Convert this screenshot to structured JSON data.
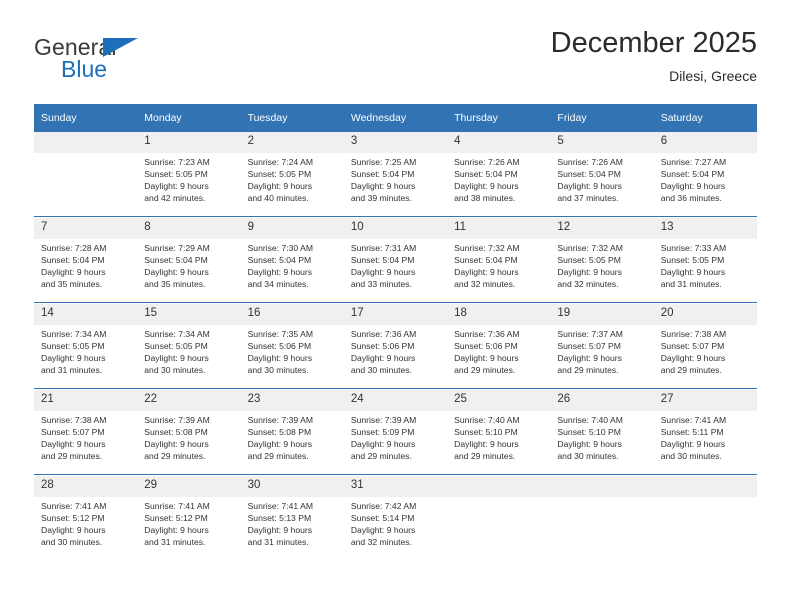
{
  "brand": {
    "name_part1": "General",
    "name_part2": "Blue",
    "triangle_color": "#1c6fba",
    "text_color": "#3a3a3a"
  },
  "header": {
    "title": "December 2025",
    "subtitle": "Dilesi, Greece"
  },
  "theme": {
    "header_blue": "#3273b4",
    "daynum_background": "#f0f0f0",
    "page_background": "#ffffff",
    "text_color": "#333333"
  },
  "calendar": {
    "weekday_headers": [
      "Sunday",
      "Monday",
      "Tuesday",
      "Wednesday",
      "Thursday",
      "Friday",
      "Saturday"
    ],
    "weeks": [
      {
        "days": [
          {
            "number": "",
            "lines": []
          },
          {
            "number": "1",
            "lines": [
              "Sunrise: 7:23 AM",
              "Sunset: 5:05 PM",
              "Daylight: 9 hours",
              "and 42 minutes."
            ]
          },
          {
            "number": "2",
            "lines": [
              "Sunrise: 7:24 AM",
              "Sunset: 5:05 PM",
              "Daylight: 9 hours",
              "and 40 minutes."
            ]
          },
          {
            "number": "3",
            "lines": [
              "Sunrise: 7:25 AM",
              "Sunset: 5:04 PM",
              "Daylight: 9 hours",
              "and 39 minutes."
            ]
          },
          {
            "number": "4",
            "lines": [
              "Sunrise: 7:26 AM",
              "Sunset: 5:04 PM",
              "Daylight: 9 hours",
              "and 38 minutes."
            ]
          },
          {
            "number": "5",
            "lines": [
              "Sunrise: 7:26 AM",
              "Sunset: 5:04 PM",
              "Daylight: 9 hours",
              "and 37 minutes."
            ]
          },
          {
            "number": "6",
            "lines": [
              "Sunrise: 7:27 AM",
              "Sunset: 5:04 PM",
              "Daylight: 9 hours",
              "and 36 minutes."
            ]
          }
        ]
      },
      {
        "days": [
          {
            "number": "7",
            "lines": [
              "Sunrise: 7:28 AM",
              "Sunset: 5:04 PM",
              "Daylight: 9 hours",
              "and 35 minutes."
            ]
          },
          {
            "number": "8",
            "lines": [
              "Sunrise: 7:29 AM",
              "Sunset: 5:04 PM",
              "Daylight: 9 hours",
              "and 35 minutes."
            ]
          },
          {
            "number": "9",
            "lines": [
              "Sunrise: 7:30 AM",
              "Sunset: 5:04 PM",
              "Daylight: 9 hours",
              "and 34 minutes."
            ]
          },
          {
            "number": "10",
            "lines": [
              "Sunrise: 7:31 AM",
              "Sunset: 5:04 PM",
              "Daylight: 9 hours",
              "and 33 minutes."
            ]
          },
          {
            "number": "11",
            "lines": [
              "Sunrise: 7:32 AM",
              "Sunset: 5:04 PM",
              "Daylight: 9 hours",
              "and 32 minutes."
            ]
          },
          {
            "number": "12",
            "lines": [
              "Sunrise: 7:32 AM",
              "Sunset: 5:05 PM",
              "Daylight: 9 hours",
              "and 32 minutes."
            ]
          },
          {
            "number": "13",
            "lines": [
              "Sunrise: 7:33 AM",
              "Sunset: 5:05 PM",
              "Daylight: 9 hours",
              "and 31 minutes."
            ]
          }
        ]
      },
      {
        "days": [
          {
            "number": "14",
            "lines": [
              "Sunrise: 7:34 AM",
              "Sunset: 5:05 PM",
              "Daylight: 9 hours",
              "and 31 minutes."
            ]
          },
          {
            "number": "15",
            "lines": [
              "Sunrise: 7:34 AM",
              "Sunset: 5:05 PM",
              "Daylight: 9 hours",
              "and 30 minutes."
            ]
          },
          {
            "number": "16",
            "lines": [
              "Sunrise: 7:35 AM",
              "Sunset: 5:06 PM",
              "Daylight: 9 hours",
              "and 30 minutes."
            ]
          },
          {
            "number": "17",
            "lines": [
              "Sunrise: 7:36 AM",
              "Sunset: 5:06 PM",
              "Daylight: 9 hours",
              "and 30 minutes."
            ]
          },
          {
            "number": "18",
            "lines": [
              "Sunrise: 7:36 AM",
              "Sunset: 5:06 PM",
              "Daylight: 9 hours",
              "and 29 minutes."
            ]
          },
          {
            "number": "19",
            "lines": [
              "Sunrise: 7:37 AM",
              "Sunset: 5:07 PM",
              "Daylight: 9 hours",
              "and 29 minutes."
            ]
          },
          {
            "number": "20",
            "lines": [
              "Sunrise: 7:38 AM",
              "Sunset: 5:07 PM",
              "Daylight: 9 hours",
              "and 29 minutes."
            ]
          }
        ]
      },
      {
        "days": [
          {
            "number": "21",
            "lines": [
              "Sunrise: 7:38 AM",
              "Sunset: 5:07 PM",
              "Daylight: 9 hours",
              "and 29 minutes."
            ]
          },
          {
            "number": "22",
            "lines": [
              "Sunrise: 7:39 AM",
              "Sunset: 5:08 PM",
              "Daylight: 9 hours",
              "and 29 minutes."
            ]
          },
          {
            "number": "23",
            "lines": [
              "Sunrise: 7:39 AM",
              "Sunset: 5:08 PM",
              "Daylight: 9 hours",
              "and 29 minutes."
            ]
          },
          {
            "number": "24",
            "lines": [
              "Sunrise: 7:39 AM",
              "Sunset: 5:09 PM",
              "Daylight: 9 hours",
              "and 29 minutes."
            ]
          },
          {
            "number": "25",
            "lines": [
              "Sunrise: 7:40 AM",
              "Sunset: 5:10 PM",
              "Daylight: 9 hours",
              "and 29 minutes."
            ]
          },
          {
            "number": "26",
            "lines": [
              "Sunrise: 7:40 AM",
              "Sunset: 5:10 PM",
              "Daylight: 9 hours",
              "and 30 minutes."
            ]
          },
          {
            "number": "27",
            "lines": [
              "Sunrise: 7:41 AM",
              "Sunset: 5:11 PM",
              "Daylight: 9 hours",
              "and 30 minutes."
            ]
          }
        ]
      },
      {
        "days": [
          {
            "number": "28",
            "lines": [
              "Sunrise: 7:41 AM",
              "Sunset: 5:12 PM",
              "Daylight: 9 hours",
              "and 30 minutes."
            ]
          },
          {
            "number": "29",
            "lines": [
              "Sunrise: 7:41 AM",
              "Sunset: 5:12 PM",
              "Daylight: 9 hours",
              "and 31 minutes."
            ]
          },
          {
            "number": "30",
            "lines": [
              "Sunrise: 7:41 AM",
              "Sunset: 5:13 PM",
              "Daylight: 9 hours",
              "and 31 minutes."
            ]
          },
          {
            "number": "31",
            "lines": [
              "Sunrise: 7:42 AM",
              "Sunset: 5:14 PM",
              "Daylight: 9 hours",
              "and 32 minutes."
            ]
          },
          {
            "number": "",
            "lines": []
          },
          {
            "number": "",
            "lines": []
          },
          {
            "number": "",
            "lines": []
          }
        ]
      }
    ]
  }
}
